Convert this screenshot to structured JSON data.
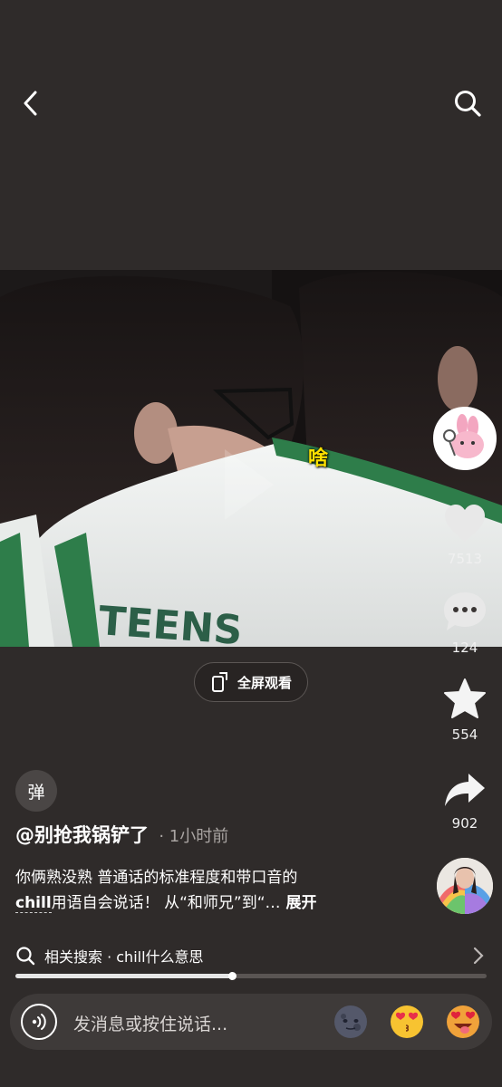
{
  "top_bar": {
    "back_icon": "chevron-left-icon",
    "search_icon": "search-icon"
  },
  "video": {
    "caption": "啥",
    "jersey_text": "TEENS"
  },
  "fullscreen": {
    "label": "全屏观看"
  },
  "rail": {
    "like_count": "7513",
    "comment_count": "124",
    "favorite_count": "554",
    "share_count": "902"
  },
  "danmaku": {
    "label": "弹"
  },
  "post": {
    "author": "@别抢我锅铲了",
    "time": "· 1小时前",
    "desc_line1": "你俩熟没熟 普通话的标准程度和带口音的",
    "desc_chill": "chill",
    "desc_line2_rest": "用语自会说话！ 从“和师兄”到“…",
    "expand": "展开"
  },
  "related": {
    "label": "相关搜索 · chill什么意思"
  },
  "progress": {
    "fraction": 0.46
  },
  "composer": {
    "placeholder": "发消息或按住说话..."
  },
  "colors": {
    "background": "#2f2b2a",
    "caption": "#ffe100",
    "jersey_green": "#2e7d4a"
  }
}
